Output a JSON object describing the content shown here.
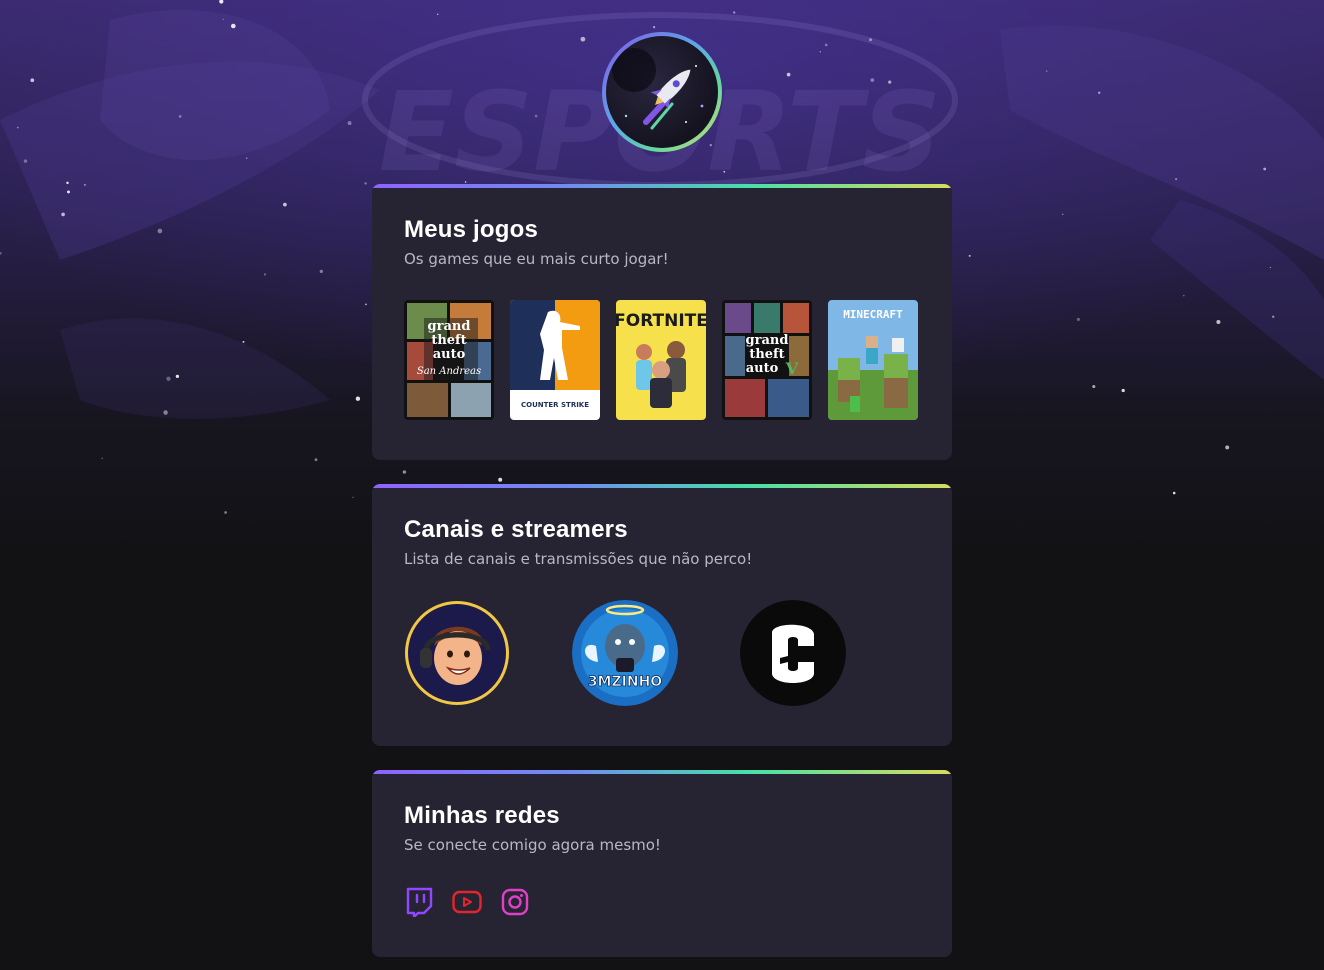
{
  "profile": {
    "avatar_icon": "rocket-icon"
  },
  "background": {
    "emblem_text": "ESPORTS"
  },
  "games": {
    "title": "Meus jogos",
    "subtitle": "Os games que eu mais curto jogar!",
    "items": [
      {
        "name": "Grand Theft Auto San Andreas",
        "cover_text": [
          "grand",
          "theft",
          "auto",
          "San Andreas"
        ]
      },
      {
        "name": "Counter Strike",
        "cover_text": [
          "COUNTER STRIKE"
        ]
      },
      {
        "name": "Fortnite",
        "cover_text": [
          "FORTNITE"
        ]
      },
      {
        "name": "Grand Theft Auto V",
        "cover_text": [
          "grand",
          "theft",
          "auto",
          "V"
        ]
      },
      {
        "name": "Minecraft",
        "cover_text": [
          "MINECRAFT"
        ]
      }
    ]
  },
  "channels": {
    "title": "Canais e streamers",
    "subtitle": "Lista de canais e transmissões que não perco!",
    "items": [
      {
        "avatar": "cartoon-streamer-avatar"
      },
      {
        "avatar": "3mzinho-avatar",
        "text": "3MZINHO"
      },
      {
        "avatar": "gaules-logo-avatar"
      }
    ]
  },
  "social": {
    "title": "Minhas redes",
    "subtitle": "Se conecte comigo agora mesmo!",
    "items": [
      {
        "icon": "twitch-icon",
        "color": "#9146ff"
      },
      {
        "icon": "youtube-icon",
        "color": "#e3262c"
      },
      {
        "icon": "instagram-icon",
        "color": "#e040c8"
      }
    ]
  },
  "colors": {
    "background": "#121214",
    "card": "#262432",
    "accent_gradient": [
      "#8f63ff",
      "#47e0a8",
      "#d9dc5e"
    ]
  }
}
